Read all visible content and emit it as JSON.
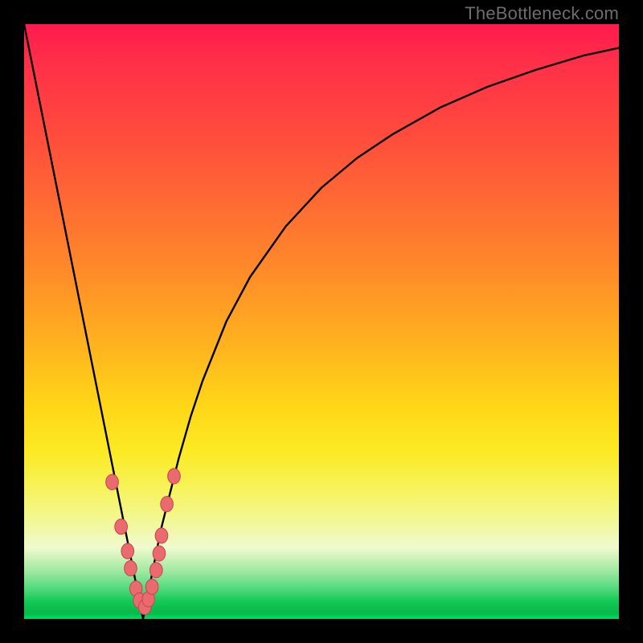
{
  "watermark": "TheBottleneck.com",
  "colors": {
    "frame": "#000000",
    "watermark_text": "#6d6d6d",
    "curve_stroke": "#000000",
    "marker_fill": "#e96b6f",
    "marker_stroke": "#c94a4e",
    "gradient_stops": [
      "#ff1a4d",
      "#ff6a33",
      "#ffd617",
      "#f3f78f",
      "#15c957"
    ]
  },
  "chart_data": {
    "type": "line",
    "title": "",
    "xlabel": "",
    "ylabel": "",
    "xlim": [
      0,
      100
    ],
    "ylim": [
      0,
      100
    ],
    "grid": false,
    "notes": "V-shaped curve with sharp minimum near x≈20; y reads as absolute deviation (%) on a red→green vertical gradient background.",
    "series": [
      {
        "name": "curve",
        "x": [
          0,
          2,
          4,
          6,
          8,
          10,
          12,
          14,
          15,
          16,
          17,
          18,
          19,
          19.5,
          20,
          20.5,
          21,
          22,
          23,
          24,
          26,
          28,
          30,
          34,
          38,
          44,
          50,
          56,
          62,
          70,
          78,
          86,
          94,
          100
        ],
        "y": [
          100,
          90,
          80,
          70,
          60,
          50,
          40,
          30,
          25,
          20,
          15,
          10,
          5,
          2.5,
          0,
          2.5,
          5,
          10,
          15,
          19,
          27,
          34,
          40,
          50,
          57.5,
          66,
          72.5,
          77.5,
          81.5,
          86,
          89.5,
          92.3,
          94.7,
          96
        ]
      }
    ],
    "markers": {
      "name": "salmon-dots",
      "x": [
        14.8,
        16.3,
        17.4,
        17.9,
        18.8,
        19.4,
        20.3,
        20.9,
        21.5,
        22.2,
        22.7,
        23.1,
        24.0,
        25.2
      ],
      "y": [
        23.0,
        15.5,
        11.4,
        8.5,
        5.1,
        3.1,
        2.0,
        3.3,
        5.4,
        8.2,
        11.0,
        14.0,
        19.3,
        24.0
      ]
    }
  }
}
